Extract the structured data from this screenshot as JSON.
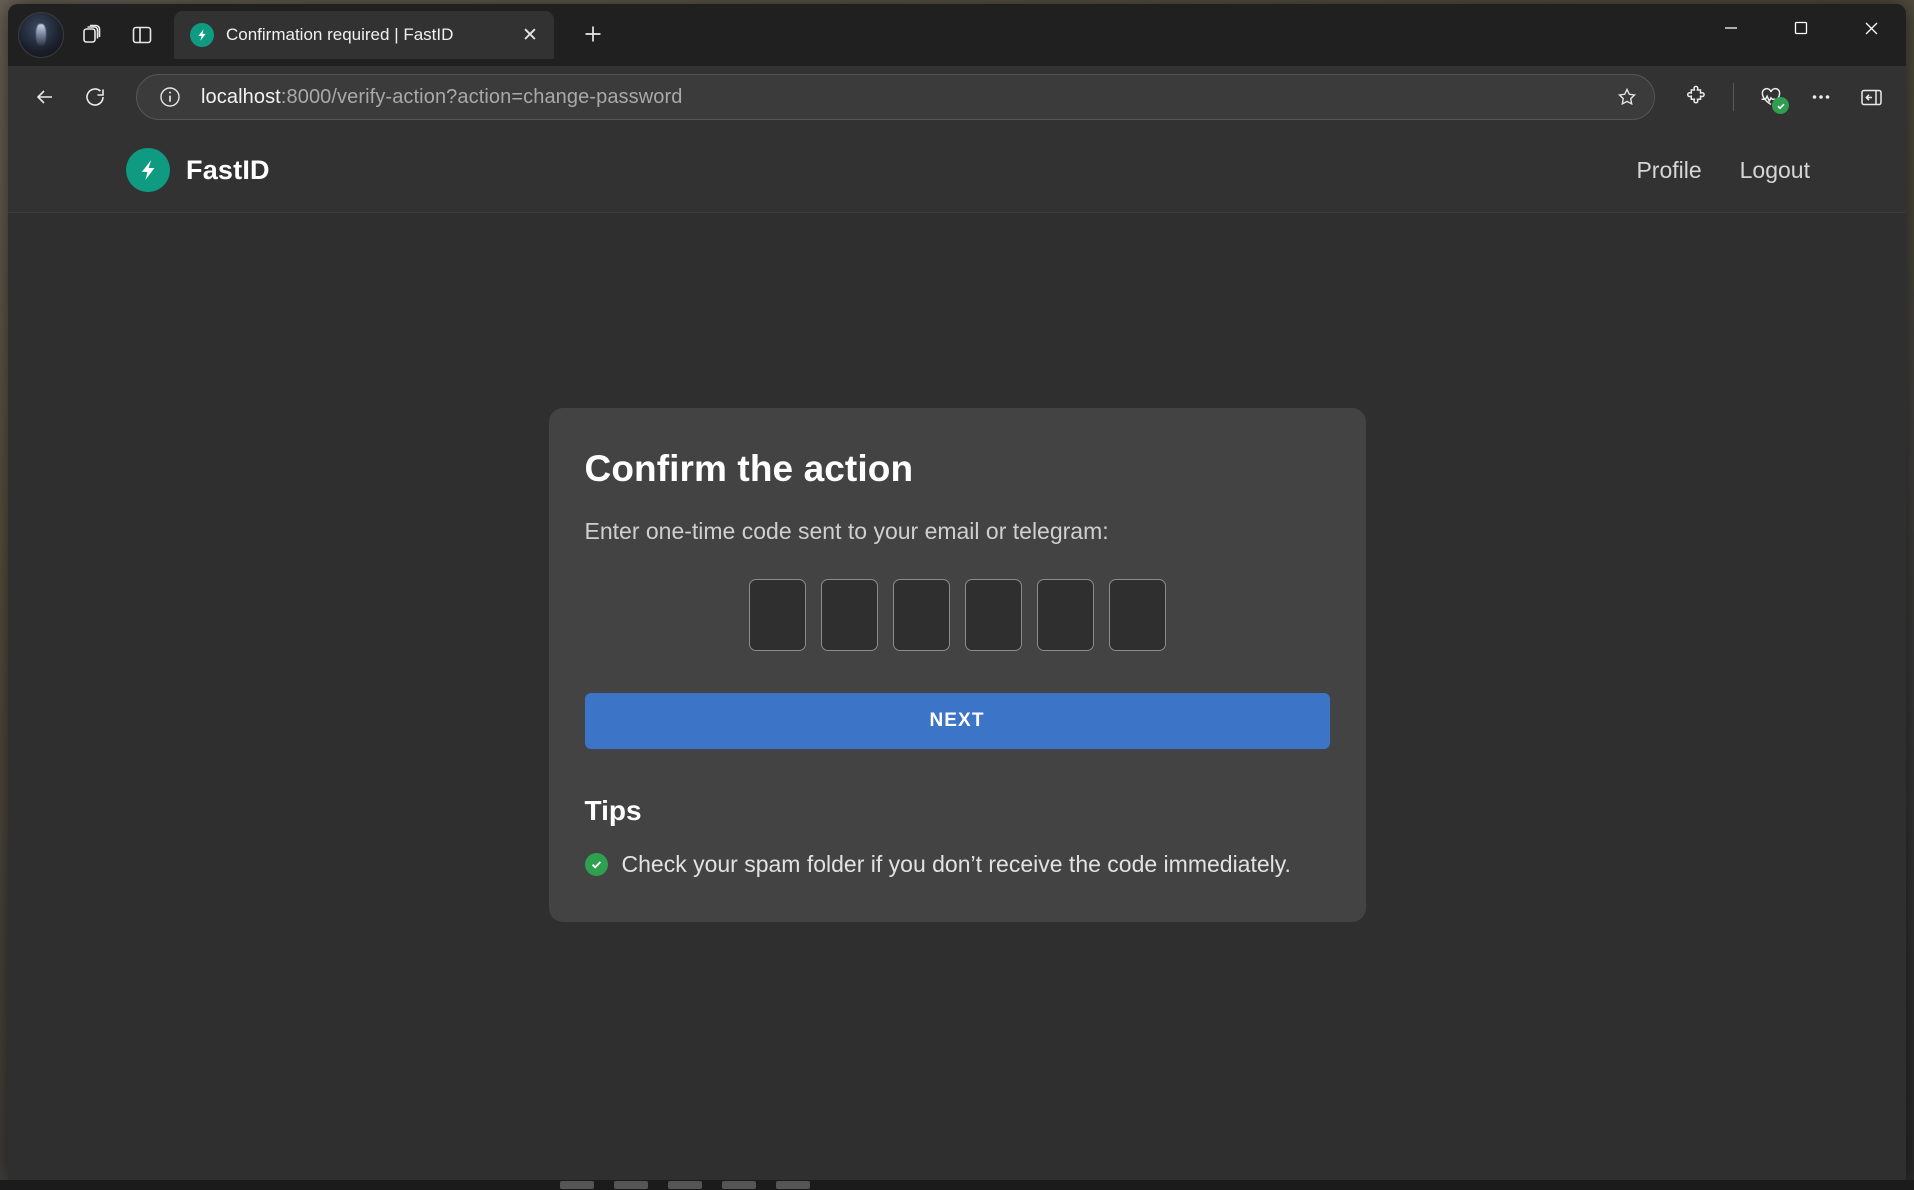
{
  "browser": {
    "window_controls": {
      "minimize": "—",
      "maximize": "☐",
      "close": "✕"
    },
    "tab": {
      "title": "Confirmation required | FastID",
      "favicon_name": "fastid-bolt-icon",
      "close_label": "✕"
    },
    "new_tab_label": "+",
    "toolbar": {
      "back_label": "Back",
      "reload_label": "Reload",
      "site_info_label": "View site information",
      "url_host": "localhost",
      "url_rest": ":8000/verify-action?action=change-password",
      "favorite_label": "Add this page to favorites",
      "extensions_label": "Extensions",
      "browser_essentials_label": "Browser essentials",
      "settings_label": "Settings and more",
      "sidebar_label": "Split screen"
    },
    "profile_avatar_label": "Profile"
  },
  "site": {
    "brand": {
      "name": "FastID",
      "logo_name": "fastid-bolt-icon",
      "accent": "#0f9b82"
    },
    "nav": [
      {
        "label": "Profile",
        "name": "nav-link-profile"
      },
      {
        "label": "Logout",
        "name": "nav-link-logout"
      }
    ]
  },
  "main": {
    "title": "Confirm the action",
    "subtitle": "Enter one-time code sent to your email or telegram:",
    "otp": {
      "length": 6,
      "digits": [
        "",
        "",
        "",
        "",
        "",
        ""
      ],
      "placeholder": ""
    },
    "submit_label": "NEXT",
    "submit_color": "#3c74c8",
    "tips": {
      "heading": "Tips",
      "items": [
        {
          "icon_name": "check-circle-icon",
          "icon_color": "#2fa04f",
          "text": "Check your spam folder if you don’t receive the code immediately."
        }
      ]
    }
  },
  "colors": {
    "page_bg": "#2f2f2f",
    "card_bg": "#434343",
    "header_bg": "#323232",
    "chrome_bg": "#202020"
  }
}
